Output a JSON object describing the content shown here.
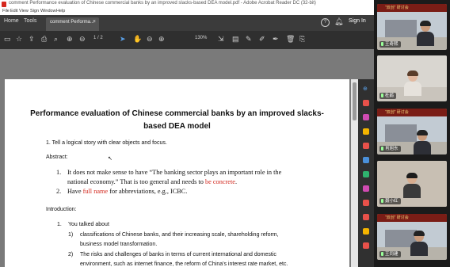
{
  "window": {
    "title": "comment Performance evaluation of Chinese commercial banks by an improved slacks-based DEA model.pdf - Adobe Acrobat Reader DC (32-bit)"
  },
  "menu": [
    "File",
    "Edit",
    "View",
    "Sign",
    "Window",
    "Help"
  ],
  "tabs": {
    "home": "Home",
    "tools": "Tools",
    "doc": "comment Performa...",
    "sign_in": "Sign In"
  },
  "toolbar": {
    "page_current": "1",
    "page_total": "/ 2",
    "zoom": "130%"
  },
  "document": {
    "title_line1": "Performance evaluation of Chinese commercial banks by an improved slacks-",
    "title_line2": "based DEA model",
    "point1": "1. Tell a logical story with clear objects and focus.",
    "abstract_label": "Abstract:",
    "abs1_num": "1.",
    "abs1_a": "It does not make sense to have “The banking sector plays an important role in the",
    "abs1_b_pre": "national economy.” That is too general and needs to ",
    "abs1_b_red": "be concrete",
    "abs1_b_post": ".",
    "abs2_num": "2.",
    "abs2_pre": "Have ",
    "abs2_red": "full name",
    "abs2_post": " for abbreviations, e.g., ICBC.",
    "intro_label": "Introduction:",
    "intro1_num": "1.",
    "intro1_text": "You talked about",
    "sub1_num": "1)",
    "sub1_a": "classifications of Chinese banks, and their increasing scale, shareholding reform,",
    "sub1_b": "business model transformation.",
    "sub2_num": "2)",
    "sub2_a": "The risks and challenges of banks in terms of current international and domestic",
    "sub2_b": "environment, such as internet finance, the reform of China's interest rate market, etc."
  },
  "video": {
    "banner": "“双创” 研讨会",
    "participants": [
      {
        "name": "王奇熙"
      },
      {
        "name": "杜鹃"
      },
      {
        "name": "肖旭东"
      },
      {
        "name": "聂小红"
      },
      {
        "name": "王同建"
      }
    ]
  },
  "colors": {
    "accent_red": "#d2281e",
    "tab_bar": "#3b3b3b",
    "toolbar": "#2f2f2f"
  }
}
